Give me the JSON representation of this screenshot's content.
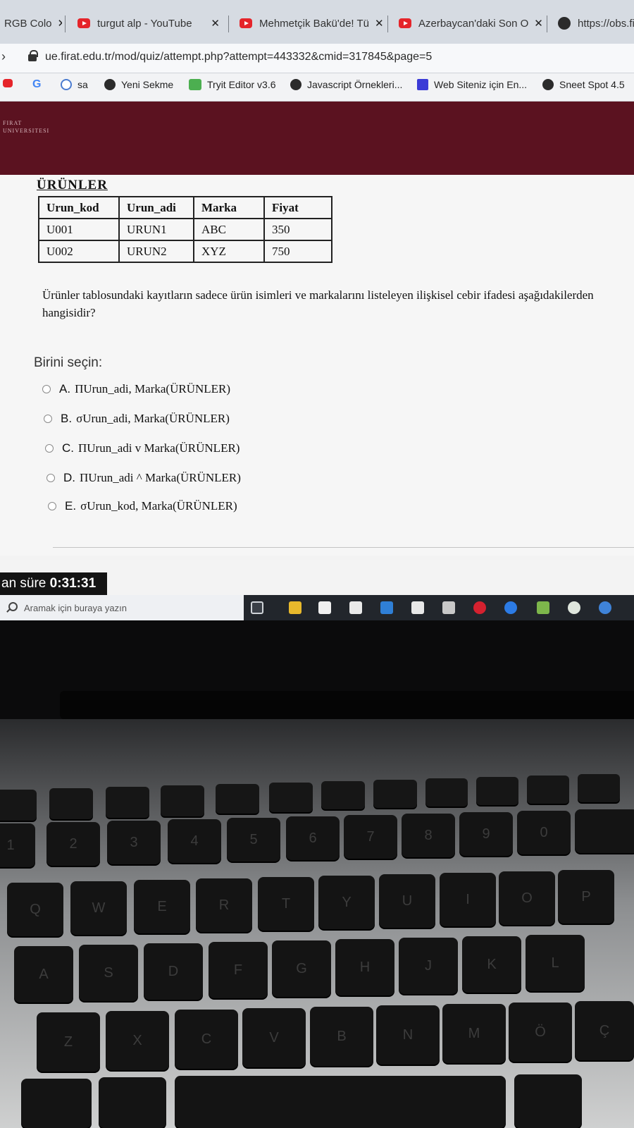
{
  "browser": {
    "tabs": [
      {
        "label": "RGB Colo",
        "icon": "none"
      },
      {
        "label": "turgut alp - YouTube",
        "icon": "youtube-icon"
      },
      {
        "label": "Mehmetçik Bakü'de! Tü",
        "icon": "youtube-icon"
      },
      {
        "label": "Azerbaycan'daki Son O",
        "icon": "youtube-icon"
      },
      {
        "label": "https://obs.fir",
        "icon": "globe-icon"
      }
    ],
    "tab_close_glyph": "✕",
    "url": "ue.firat.edu.tr/mod/quiz/attempt.php?attempt=443332&cmid=317845&page=5",
    "bookmarks": [
      {
        "label": "sa"
      },
      {
        "label": "Yeni Sekme"
      },
      {
        "label": "Tryit Editor v3.6"
      },
      {
        "label": "Javascript Örnekleri..."
      },
      {
        "label": "Web Siteniz için En..."
      },
      {
        "label": "Sneet Spot 4.5"
      }
    ],
    "bookmark_g": "G"
  },
  "site": {
    "logo_line1": "FIRAT",
    "logo_line2": "UNIVERSITESI"
  },
  "quiz": {
    "table_title": "ÜRÜNLER",
    "table": {
      "headers": [
        "Urun_kod",
        "Urun_adi",
        "Marka",
        "Fiyat"
      ],
      "rows": [
        [
          "U001",
          "URUN1",
          "ABC",
          "350"
        ],
        [
          "U002",
          "URUN2",
          "XYZ",
          "750"
        ]
      ]
    },
    "question": "Ürünler tablosundaki kayıtların sadece ürün isimleri ve markalarını listeleyen ilişkisel cebir ifadesi aşağıdakilerden hangisidir?",
    "choose_label": "Birini seçin:",
    "options": [
      {
        "letter": "A.",
        "text": "ΠUrun_adi, Marka(ÜRÜNLER)"
      },
      {
        "letter": "B.",
        "text": "σUrun_adi, Marka(ÜRÜNLER)"
      },
      {
        "letter": "C.",
        "text": "ΠUrun_adi v Marka(ÜRÜNLER)"
      },
      {
        "letter": "D.",
        "text": "ΠUrun_adi ^ Marka(ÜRÜNLER)"
      },
      {
        "letter": "E.",
        "text": "σUrun_kod, Marka(ÜRÜNLER)"
      }
    ],
    "timer_label": "an süre",
    "timer_value": "0:31:31"
  },
  "taskbar": {
    "search_placeholder": "Aramak için buraya yazın",
    "icons": [
      "task-view-icon",
      "file-explorer-icon",
      "store-icon",
      "calculator-icon",
      "mail-icon",
      "yandex-icon",
      "app-icon",
      "opera-icon",
      "edge-icon",
      "notepad-icon",
      "chrome-icon",
      "app2-icon"
    ]
  },
  "keyboard": {
    "row1": [
      "1",
      "2",
      "3",
      "4",
      "5",
      "6",
      "7",
      "8",
      "9",
      "0"
    ],
    "row2": [
      "Q",
      "W",
      "E",
      "R",
      "T",
      "Y",
      "U",
      "I",
      "O",
      "P"
    ],
    "row3": [
      "A",
      "S",
      "D",
      "F",
      "G",
      "H",
      "J",
      "K",
      "L"
    ],
    "row4": [
      "Z",
      "X",
      "C",
      "V",
      "B",
      "N",
      "M",
      "Ö",
      "Ç"
    ]
  }
}
